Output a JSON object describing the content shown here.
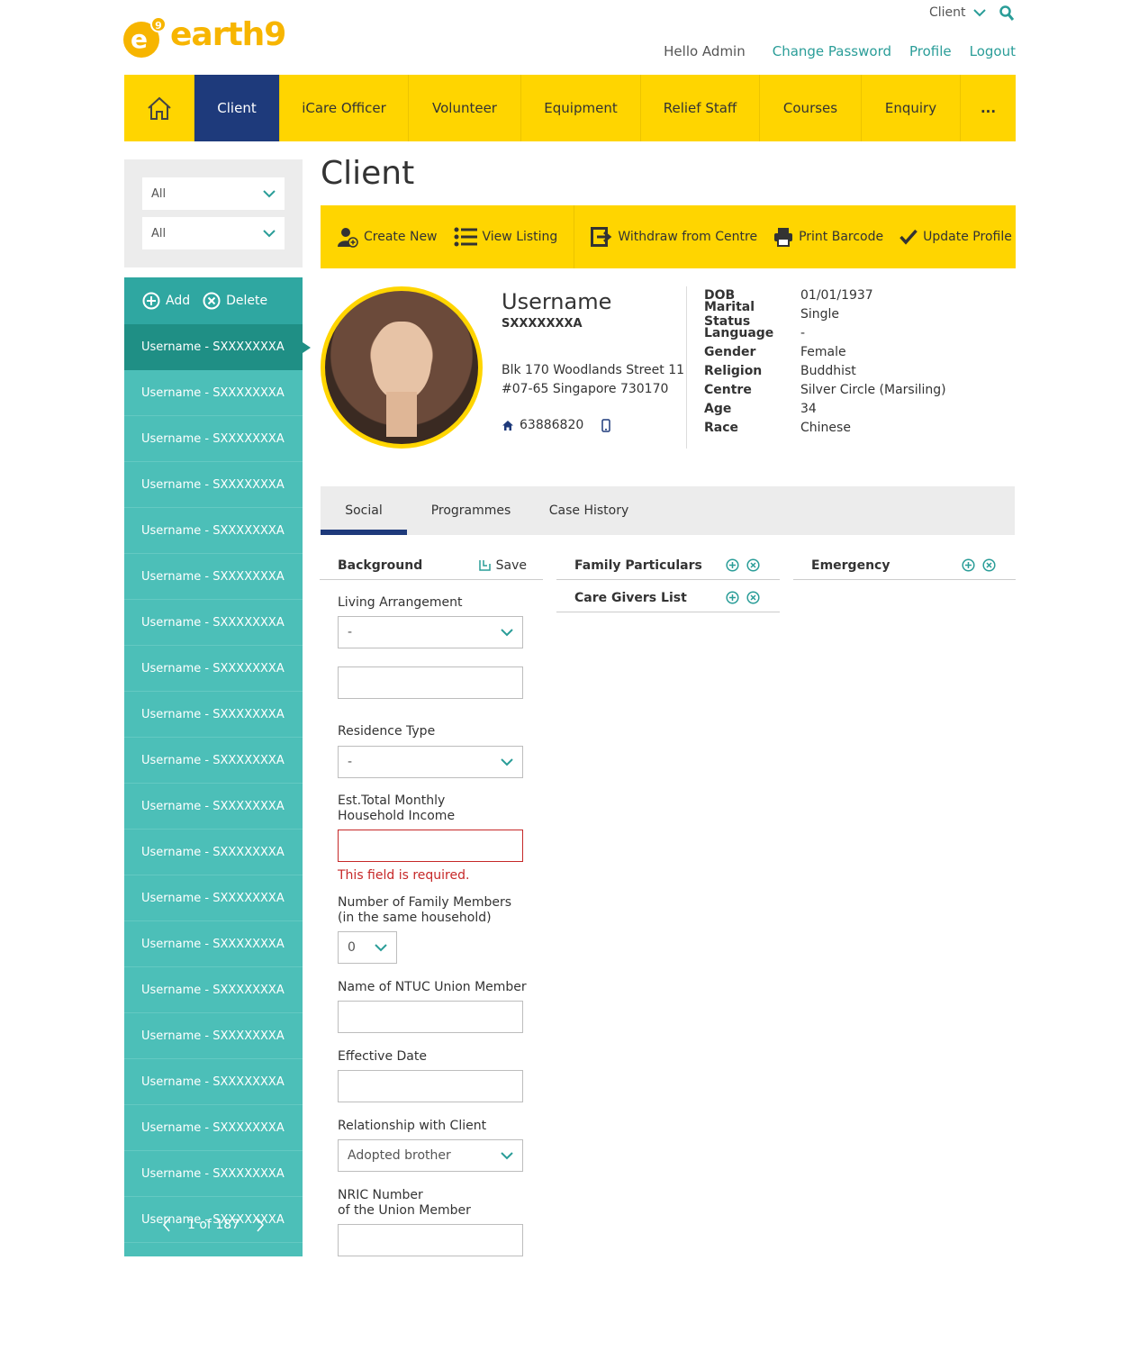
{
  "header": {
    "logo_mark": "e",
    "logo_sup": "9",
    "logo_text": "earth9",
    "module_select": "Client",
    "greeting": "Hello Admin",
    "links": [
      "Change Password",
      "Profile",
      "Logout"
    ]
  },
  "nav": {
    "items": [
      "Client",
      "iCare Officer",
      "Volunteer",
      "Equipment",
      "Relief Staff",
      "Courses",
      "Enquiry",
      "..."
    ],
    "active": "Client"
  },
  "sidebar": {
    "filters": [
      "All",
      "All"
    ],
    "add_label": "Add",
    "delete_label": "Delete",
    "item_label": "Username - SXXXXXXXA",
    "pagination": "1 of 187"
  },
  "page": {
    "title": "Client"
  },
  "toolbar": {
    "create_new": "Create New",
    "view_listing": "View Listing",
    "withdraw": "Withdraw from Centre",
    "print_barcode": "Print Barcode",
    "update_profile": "Update Profile"
  },
  "profile": {
    "username": "Username",
    "nric": "SXXXXXXXA",
    "address_line1": "Blk 170 Woodlands Street 11",
    "address_line2": "#07-65 Singapore  730170",
    "home_phone": "63886820",
    "details": [
      {
        "key": "DOB",
        "value": "01/01/1937"
      },
      {
        "key": "Marital Status",
        "value": "Single"
      },
      {
        "key": "Language",
        "value": "-"
      },
      {
        "key": "Gender",
        "value": "Female"
      },
      {
        "key": "Religion",
        "value": "Buddhist"
      },
      {
        "key": "Centre",
        "value": "Silver Circle (Marsiling)"
      },
      {
        "key": "Age",
        "value": "34"
      },
      {
        "key": "Race",
        "value": "Chinese"
      }
    ]
  },
  "tabs": [
    "Social",
    "Programmes",
    "Case History"
  ],
  "panels": {
    "background": "Background",
    "save": "Save",
    "family_particulars": "Family Particulars",
    "care_givers": "Care Givers List",
    "emergency": "Emergency"
  },
  "form": {
    "living_arrangement_label": "Living Arrangement",
    "living_arrangement_value": "-",
    "residence_type_label": "Residence Type",
    "residence_type_value": "-",
    "income_label_1": "Est.Total Monthly",
    "income_label_2": "Household Income",
    "income_error": "This field is required.",
    "family_members_label_1": "Number of Family Members",
    "family_members_label_2": "(in the same household)",
    "family_members_value": "0",
    "ntuc_label": "Name of NTUC Union Member",
    "effective_date_label": "Effective Date",
    "relationship_label": "Relationship with Client",
    "relationship_value": "Adopted brother",
    "nric_label_1": "NRIC Number",
    "nric_label_2": "of the Union Member"
  },
  "colors": {
    "brand_yellow": "#ffd500",
    "nav_active": "#1e3a7b",
    "teal": "#4cbfb8",
    "teal_dark": "#2fa7a1",
    "link": "#2a9d98",
    "error": "#c62828"
  }
}
